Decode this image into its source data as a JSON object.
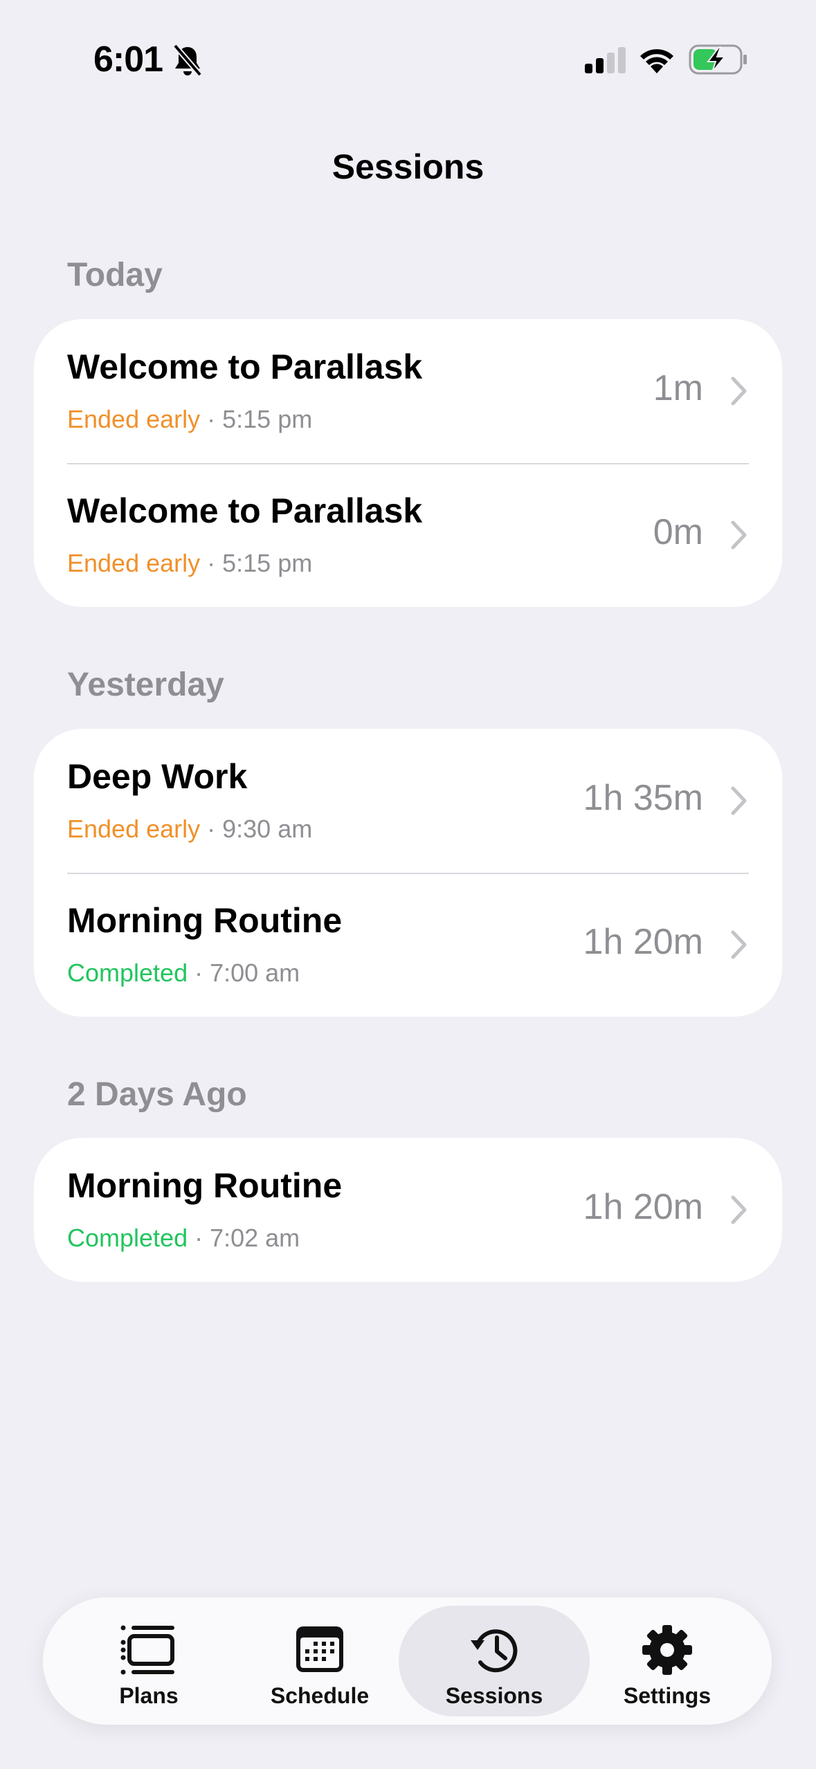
{
  "status_bar": {
    "time": "6:01"
  },
  "header": {
    "title": "Sessions"
  },
  "sections": [
    {
      "title": "Today",
      "items": [
        {
          "title": "Welcome to Parallask",
          "status": "Ended early",
          "time": "5:15 pm",
          "duration": "1m"
        },
        {
          "title": "Welcome to Parallask",
          "status": "Ended early",
          "time": "5:15 pm",
          "duration": "0m"
        }
      ]
    },
    {
      "title": "Yesterday",
      "items": [
        {
          "title": "Deep Work",
          "status": "Ended early",
          "time": "9:30 am",
          "duration": "1h 35m"
        },
        {
          "title": "Morning Routine",
          "status": "Completed",
          "time": "7:00 am",
          "duration": "1h 20m"
        }
      ]
    },
    {
      "title": "2 Days Ago",
      "items": [
        {
          "title": "Morning Routine",
          "status": "Completed",
          "time": "7:02 am",
          "duration": "1h 20m"
        }
      ]
    }
  ],
  "separator": "·",
  "tab_bar": {
    "tabs": [
      {
        "label": "Plans",
        "icon": "plans-icon"
      },
      {
        "label": "Schedule",
        "icon": "calendar-icon"
      },
      {
        "label": "Sessions",
        "icon": "history-icon",
        "active": true
      },
      {
        "label": "Settings",
        "icon": "gear-icon"
      }
    ]
  },
  "colors": {
    "background": "#f0eff5",
    "ended_early": "#f0902a",
    "completed": "#22c55e",
    "secondary_text": "#8e8e93",
    "battery_fill": "#34c759"
  }
}
